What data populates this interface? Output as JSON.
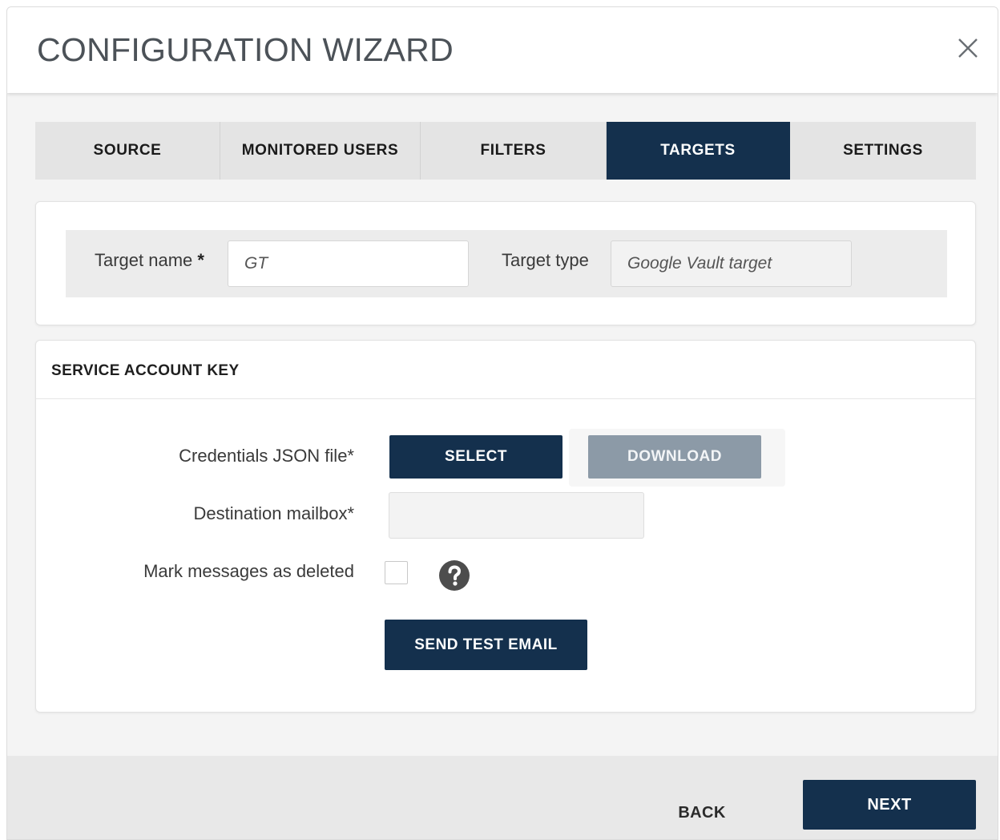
{
  "dialog": {
    "title": "CONFIGURATION WIZARD",
    "close_icon": "close-icon"
  },
  "tabs": [
    {
      "label": "SOURCE",
      "active": false
    },
    {
      "label": "MONITORED USERS",
      "active": false
    },
    {
      "label": "FILTERS",
      "active": false
    },
    {
      "label": "TARGETS",
      "active": true
    },
    {
      "label": "SETTINGS",
      "active": false
    }
  ],
  "target": {
    "name_label": "Target name",
    "name_required": "*",
    "name_value": "GT",
    "type_label": "Target type",
    "type_value": "Google Vault target"
  },
  "service_account": {
    "title": "SERVICE ACCOUNT KEY",
    "credentials_label": "Credentials JSON file*",
    "select_label": "SELECT",
    "download_label": "DOWNLOAD",
    "mailbox_label": "Destination mailbox*",
    "mailbox_value": "",
    "mark_deleted_label": "Mark messages as deleted",
    "mark_deleted_checked": false,
    "help_icon": "help-icon",
    "send_test_label": "SEND TEST EMAIL"
  },
  "footer": {
    "back_label": "BACK",
    "next_label": "NEXT"
  },
  "colors": {
    "primary": "#14304d",
    "disabled_button": "#8c9aa7",
    "tab_bg": "#e4e4e4"
  }
}
